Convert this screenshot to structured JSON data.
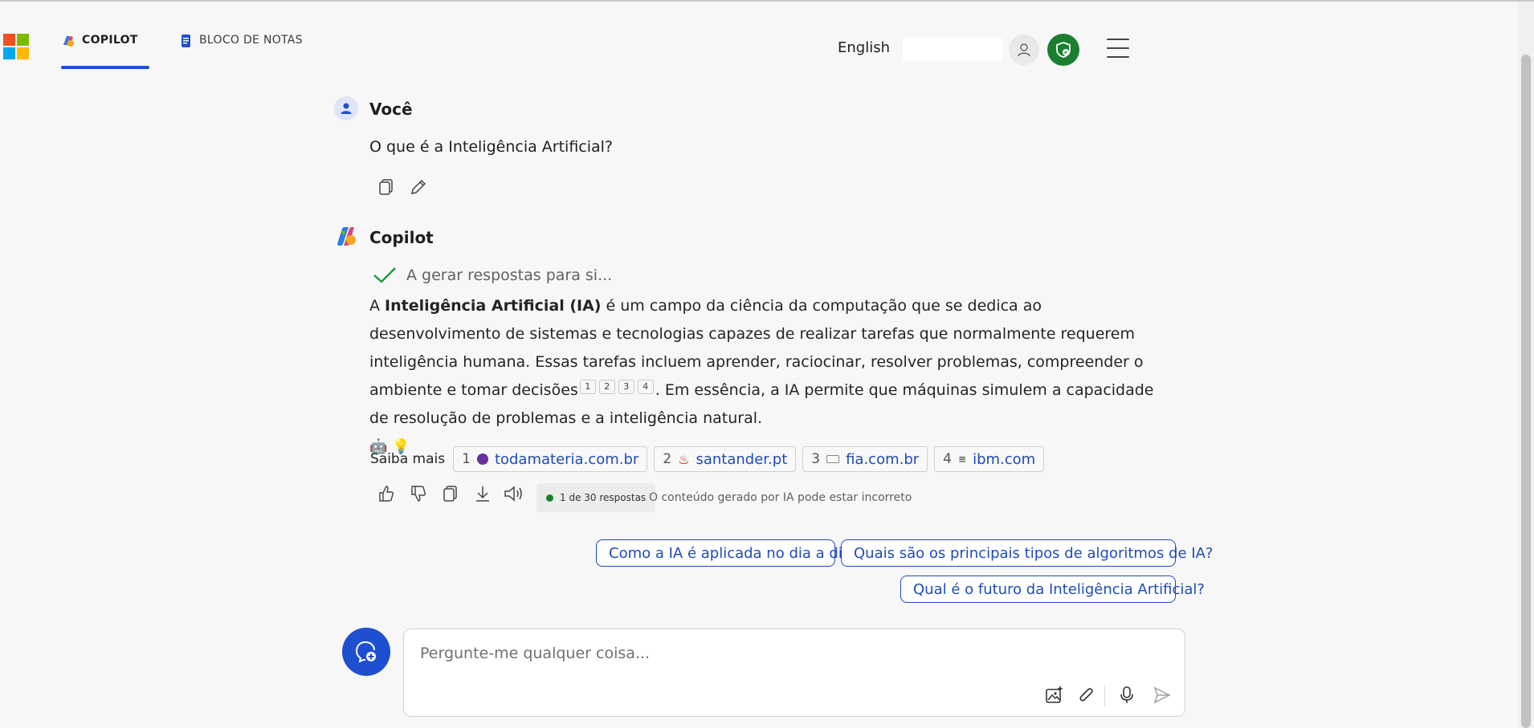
{
  "header": {
    "tabs": [
      {
        "label": "COPILOT",
        "active": true
      },
      {
        "label": "BLOCO DE NOTAS",
        "active": false
      }
    ],
    "language": "English"
  },
  "conversation": {
    "user": {
      "name": "Você",
      "message": "O que é a Inteligência Artificial?"
    },
    "copilot": {
      "name": "Copilot",
      "status": "A gerar respostas para si...",
      "answer": {
        "intro": "A ",
        "bold": "Inteligência Artificial (IA)",
        "part1": " é um campo da ciência da computação que se dedica ao desenvolvimento de sistemas e tecnologias capazes de realizar tarefas que normalmente requerem inteligência humana. Essas tarefas incluem aprender, raciocinar, resolver problemas, compreender o ambiente e tomar decisões",
        "citations": [
          "1",
          "2",
          "3",
          "4"
        ],
        "part2": ". Em essência, a IA permite que máquinas simulem a capacidade de resolução de problemas e a inteligência natural.",
        "emojis": "🤖 💡"
      },
      "learn_more": {
        "label": "Saiba mais",
        "sources": [
          {
            "num": "1",
            "domain": "todamateria.com.br",
            "color": "#6b2fa0"
          },
          {
            "num": "2",
            "domain": "santander.pt",
            "color": "#e00000"
          },
          {
            "num": "3",
            "domain": "fia.com.br",
            "color": "#888888"
          },
          {
            "num": "4",
            "domain": "ibm.com",
            "color": "#555555"
          }
        ]
      },
      "response_counter": "1 de 30 respostas",
      "disclaimer": "O conteúdo gerado por IA pode estar incorreto"
    }
  },
  "suggestions": [
    "Como a IA é aplicada no dia a dia?",
    "Quais são os principais tipos de algoritmos de IA?",
    "Qual é o futuro da Inteligência Artificial?"
  ],
  "composer": {
    "placeholder": "Pergunte-me qualquer coisa..."
  },
  "colors": {
    "accent": "#1d4fd0",
    "link": "#1f4bb8",
    "success": "#1a7f2e"
  }
}
